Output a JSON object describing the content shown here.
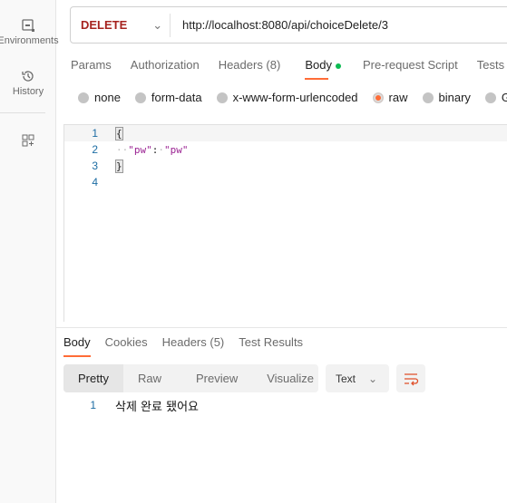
{
  "sidebar": {
    "items": [
      {
        "label": "Environments",
        "icon": "environment-icon"
      },
      {
        "label": "History",
        "icon": "history-icon"
      },
      {
        "label": "",
        "icon": "add-widget-icon"
      }
    ]
  },
  "request": {
    "method": "DELETE",
    "method_color": "#a6231f",
    "url": "http://localhost:8080/api/choiceDelete/3"
  },
  "tabs": [
    "Params",
    "Authorization",
    "Headers (8)",
    "Body",
    "Pre-request Script",
    "Tests"
  ],
  "active_tab": "Body",
  "body_modes": [
    "none",
    "form-data",
    "x-www-form-urlencoded",
    "raw",
    "binary",
    "GraphQL"
  ],
  "body_modes_visible": [
    "none",
    "form-data",
    "x-www-form-urlencoded",
    "raw",
    "binary",
    "G"
  ],
  "selected_mode": "raw",
  "editor": {
    "lines": [
      "{",
      "  \"pw\": \"pw\"",
      "}",
      ""
    ],
    "line_numbers": [
      "1",
      "2",
      "3",
      "4"
    ],
    "key": "\"pw\"",
    "value": "\"pw\"",
    "open": "{",
    "close": "}",
    "colon": ":"
  },
  "response": {
    "tabs": [
      "Body",
      "Cookies",
      "Headers (5)",
      "Test Results"
    ],
    "views": [
      "Pretty",
      "Raw",
      "Preview",
      "Visualize"
    ],
    "format": "Text",
    "line_number": "1",
    "text": "삭제 완료 됐어요"
  },
  "accent": "#ff6c37"
}
